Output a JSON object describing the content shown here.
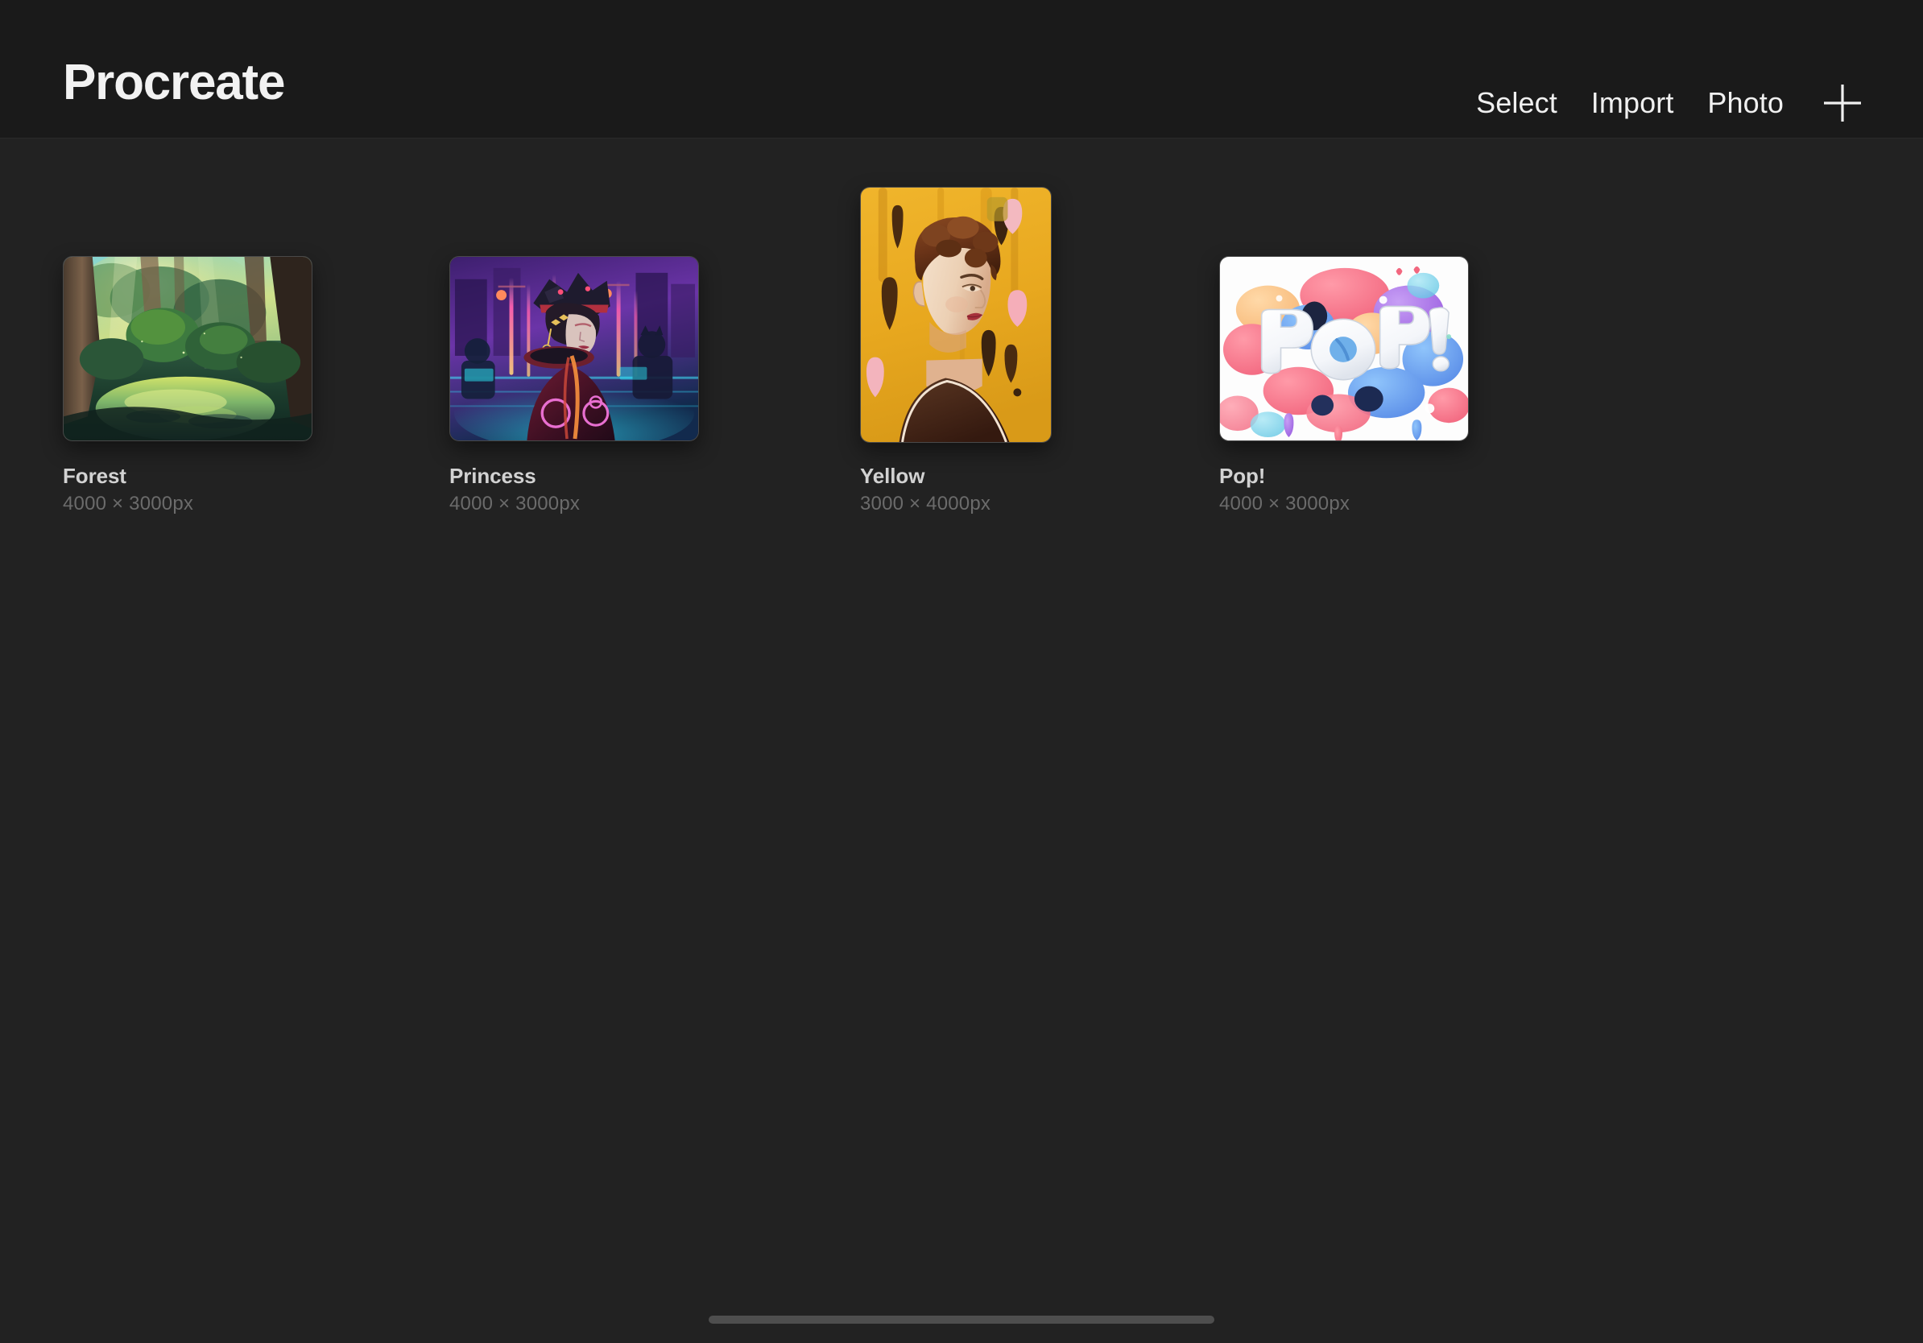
{
  "app": {
    "title": "Procreate",
    "background_color": "#222222",
    "header_background_color": "#1a1a1a"
  },
  "header": {
    "actions": [
      {
        "label": "Select",
        "name": "select-button"
      },
      {
        "label": "Import",
        "name": "import-button"
      },
      {
        "label": "Photo",
        "name": "photo-button"
      }
    ],
    "add_icon": "plus-icon"
  },
  "gallery": {
    "artworks": [
      {
        "title": "Forest",
        "dimensions": "4000 × 3000px",
        "orientation": "landscape",
        "thumbnail": "forest-thumbnail"
      },
      {
        "title": "Princess",
        "dimensions": "4000 × 3000px",
        "orientation": "landscape",
        "thumbnail": "princess-thumbnail"
      },
      {
        "title": "Yellow",
        "dimensions": "3000 × 4000px",
        "orientation": "portrait",
        "thumbnail": "yellow-thumbnail"
      },
      {
        "title": "Pop!",
        "dimensions": "4000 × 3000px",
        "orientation": "landscape",
        "thumbnail": "pop-thumbnail"
      }
    ]
  },
  "system": {
    "home_indicator": "home-indicator"
  }
}
